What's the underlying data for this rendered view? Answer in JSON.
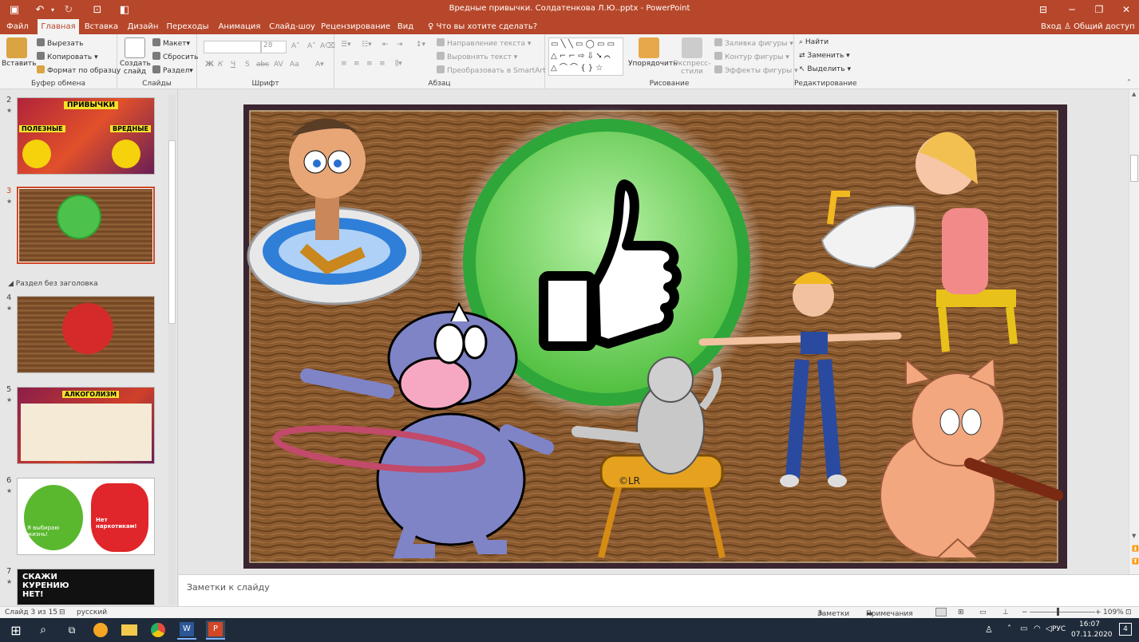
{
  "window": {
    "title": "Вредные привычки. Солдатенкова Л.Ю..pptx - PowerPoint"
  },
  "tabs": [
    {
      "label": "Файл"
    },
    {
      "label": "Главная"
    },
    {
      "label": "Вставка"
    },
    {
      "label": "Дизайн"
    },
    {
      "label": "Переходы"
    },
    {
      "label": "Анимация"
    },
    {
      "label": "Слайд-шоу"
    },
    {
      "label": "Рецензирование"
    },
    {
      "label": "Вид"
    }
  ],
  "tell_me": "Что вы хотите сделать?",
  "login": "Вход",
  "share": "Общий доступ",
  "ribbon": {
    "clipboard": {
      "paste": "Вставить",
      "cut": "Вырезать",
      "copy": "Копировать",
      "format_painter": "Формат по образцу",
      "label": "Буфер обмена"
    },
    "slides": {
      "new_slide": "Создать слайд",
      "layout": "Макет",
      "reset": "Сбросить",
      "section": "Раздел",
      "label": "Слайды"
    },
    "font": {
      "size": "28",
      "bold": "Ж",
      "italic": "К",
      "underline": "Ч",
      "shadow": "S",
      "strike": "abc",
      "spacing": "AV",
      "case": "Aa",
      "label": "Шрифт"
    },
    "paragraph": {
      "direction": "Направление текста",
      "align": "Выровнять текст",
      "smartart": "Преобразовать в SmartArt",
      "label": "Абзац"
    },
    "drawing": {
      "arrange": "Упорядочить",
      "quick_styles": "Экспресс-стили",
      "fill": "Заливка фигуры",
      "outline": "Контур фигуры",
      "effects": "Эффекты фигуры",
      "label": "Рисование"
    },
    "editing": {
      "find": "Найти",
      "replace": "Заменить",
      "select": "Выделить",
      "label": "Редактирование"
    }
  },
  "thumbnails": [
    {
      "num": "2",
      "caption": "ПРИВЫЧКИ",
      "left": "ПОЛЕЗНЫЕ",
      "right": "ВРЕДНЫЕ"
    },
    {
      "num": "3"
    },
    {
      "num": "4"
    },
    {
      "num": "5",
      "caption": "АЛКОГОЛИЗМ"
    },
    {
      "num": "6",
      "text1": "Я выбираю жизнь!",
      "text2": "Нет наркотикам!"
    },
    {
      "num": "7",
      "caption": "СКАЖИ КУРЕНИЮ НЕТ!"
    }
  ],
  "section_title": "Раздел без заголовка",
  "slide": {
    "watermark": "©LR"
  },
  "notes_placeholder": "Заметки к слайду",
  "status": {
    "slide_of": "Слайд 3 из 15",
    "language": "русский",
    "notes": "Заметки",
    "comments": "Примечания",
    "zoom": "109%"
  },
  "taskbar": {
    "lang": "РУС",
    "time": "16:07",
    "date": "07.11.2020",
    "notif": "4"
  }
}
